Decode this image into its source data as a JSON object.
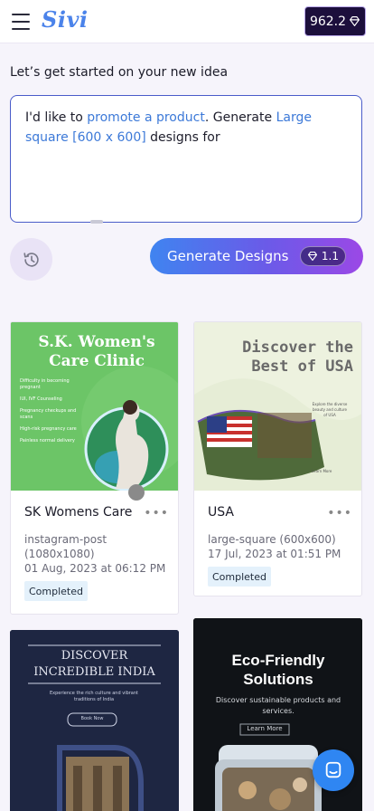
{
  "header": {
    "logo": "Sivi",
    "credits": "962.2"
  },
  "prompt": {
    "title": "Let’s get started on your new idea",
    "text_1": "I'd like to ",
    "text_highlight_1": "promote a product",
    "text_2": ". Generate ",
    "text_highlight_2": "Large square [600 x 600]",
    "text_3": " designs for"
  },
  "generate": {
    "label": "Generate Designs",
    "cost": "1.1"
  },
  "cards": [
    {
      "name": "SK Womens Care",
      "format": "instagram-post (1080x1080)",
      "date": "01 Aug, 2023 at 06:12 PM",
      "status": "Completed",
      "thumb_title": "S.K. Women's Care Clinic",
      "thumb_bullets": [
        "Difficulty in becoming pregnant",
        "IUI, IVF Counseling",
        "Pregnancy checkups and scans",
        "High-risk pregnancy care",
        "Painless normal delivery"
      ]
    },
    {
      "name": "USA",
      "format": "large-square (600x600)",
      "date": "17 Jul, 2023 at 01:51 PM",
      "status": "Completed",
      "thumb_title": "Discover the Best of USA",
      "thumb_sub": "Explore the diverse beauty and culture of USA",
      "thumb_link": "Learn More"
    },
    {
      "thumb_title": "DISCOVER INCREDIBLE INDIA",
      "thumb_sub": "Experience the rich culture and vibrant traditions of India",
      "thumb_button": "Book Now"
    },
    {
      "thumb_title": "Eco-Friendly Solutions",
      "thumb_sub": "Discover sustainable products and services.",
      "thumb_button": "Learn More"
    }
  ],
  "colors": {
    "accent": "#4b83ea",
    "credits_bg": "#1c0f3c",
    "gradient_start": "#3f84f0",
    "gradient_end": "#9b48e6",
    "badge_bg": "#e4f1fb"
  }
}
